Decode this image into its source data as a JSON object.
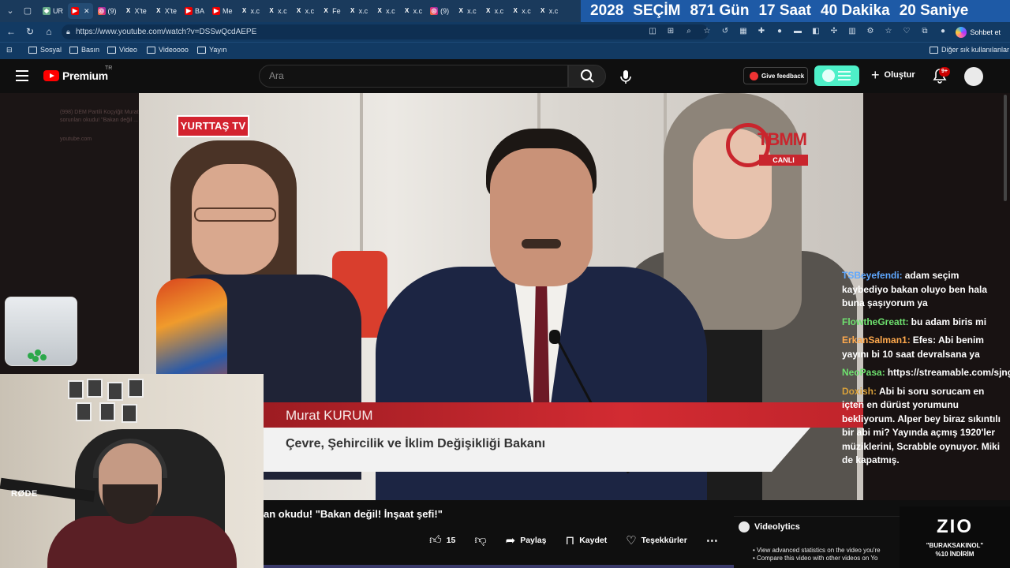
{
  "browser": {
    "tabs": [
      {
        "label": "UR",
        "icon": "favicon",
        "active": false
      },
      {
        "label": "",
        "icon": "youtube",
        "active": true
      },
      {
        "label": "(9)",
        "icon": "instagram",
        "active": false
      },
      {
        "label": "X'te",
        "icon": "x",
        "active": false
      },
      {
        "label": "X'te",
        "icon": "x",
        "active": false
      },
      {
        "label": "BA",
        "icon": "youtube",
        "active": false
      },
      {
        "label": "Me",
        "icon": "youtube",
        "active": false
      },
      {
        "label": "x.c",
        "icon": "x",
        "active": false
      },
      {
        "label": "x.c",
        "icon": "x",
        "active": false
      },
      {
        "label": "x.c",
        "icon": "x",
        "active": false
      },
      {
        "label": "Fe",
        "icon": "x",
        "active": false
      },
      {
        "label": "x.c",
        "icon": "x",
        "active": false
      },
      {
        "label": "x.c",
        "icon": "x",
        "active": false
      },
      {
        "label": "x.c",
        "icon": "x",
        "active": false
      },
      {
        "label": "(9)",
        "icon": "instagram",
        "active": false
      },
      {
        "label": "x.c",
        "icon": "x",
        "active": false
      },
      {
        "label": "x.c",
        "icon": "x",
        "active": false
      },
      {
        "label": "x.c",
        "icon": "x",
        "active": false
      },
      {
        "label": "x.c",
        "icon": "x",
        "active": false
      }
    ],
    "countdown": {
      "year": "2028",
      "label": "SEÇİM",
      "days": "871 Gün",
      "hours": "17 Saat",
      "minutes": "40 Dakika",
      "seconds": "20 Saniye"
    },
    "url": "https://www.youtube.com/watch?v=DSSwQcdAEPE",
    "chat_button": "Sohbet et",
    "bookmarks": [
      "Sosyal",
      "Basın",
      "Video",
      "Videoooo",
      "Yayın"
    ],
    "other_bookmarks": "Diğer sık kullanılanlar"
  },
  "youtube": {
    "logo": "Premium",
    "region": "TR",
    "search_placeholder": "Ara",
    "feedback": "Give feedback",
    "create": "Oluştur",
    "notifications": "9+"
  },
  "overlay_ghost": [
    "(998) DEM Partili Koçyiğit Murat K...",
    "sorunları okudu! \"Bakan değil ...",
    "youtube.com"
  ],
  "video": {
    "channel_logo": "YURTTAŞ TV",
    "broadcaster": "TBMM",
    "live": "CANLI",
    "lower_third_name": "Murat KURUM",
    "lower_third_title": "Çevre, Şehircilik ve İklim Değişikliği Bakanı",
    "title_visible": "an okudu! \"Bakan değil! İnşaat şefi!\""
  },
  "actions": {
    "likes": "15",
    "share": "Paylaş",
    "save": "Kaydet",
    "thanks": "Teşekkürler"
  },
  "chat": [
    {
      "user": "TSBeyefendi:",
      "color": "#5fa8ff",
      "text": "adam seçim kaybediyo bakan oluyo ben hala buna şaşıyorum ya"
    },
    {
      "user": "FlowtheGreatt:",
      "color": "#6ee06e",
      "text": "bu adam biris mi"
    },
    {
      "user": "ErkanSalman1:",
      "color": "#ffa94d",
      "text": "Efes: Abi benim yayını bi 10 saat devralsana ya"
    },
    {
      "user": "NeoPasa:",
      "color": "#6ee06e",
      "text": "https://streamable.com/sjng83"
    },
    {
      "user": "Doxish:",
      "color": "#d9a13a",
      "text": "Abi bi soru sorucam en içten en dürüst yorumunu bekliyorum. Alper bey biraz sıkıntılı bir abi mi? Yayında açmış 1920'ler müziklerini, Scrabble oynuyor. Miki de kapatmış."
    }
  ],
  "webcam": {
    "mic_brand": "RØDE"
  },
  "videolytics": {
    "name": "Videolytics",
    "items": [
      "View advanced statistics on the video you're",
      "Compare this video with other videos on Yo"
    ]
  },
  "ad": {
    "logo": "ZIO",
    "code": "\"BURAKSAKINOL\"",
    "discount": "%10 İNDİRİM"
  }
}
